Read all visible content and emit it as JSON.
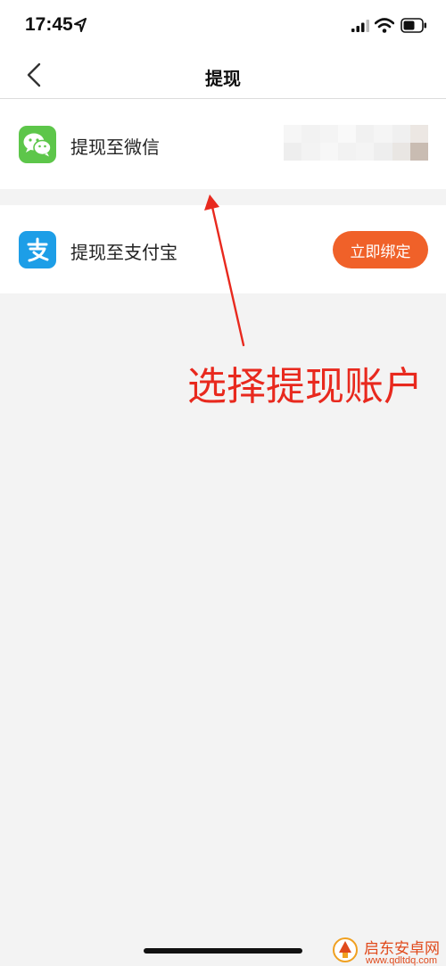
{
  "status_bar": {
    "time": "17:45",
    "icons": [
      "location-arrow-icon",
      "signal-icon",
      "wifi-icon",
      "battery-icon"
    ]
  },
  "nav": {
    "title": "提现",
    "back_icon": "chevron-left-icon"
  },
  "options": [
    {
      "label": "提现至微信",
      "icon": "wechat-icon",
      "account": ""
    },
    {
      "label": "提现至支付宝",
      "icon": "alipay-icon",
      "action_label": "立即绑定"
    }
  ],
  "annotation": {
    "text": "选择提现账户",
    "color": "#e8291e"
  },
  "watermark": {
    "name": "启东安卓网",
    "url": "www.qdltdq.com"
  },
  "colors": {
    "wechat_green": "#5dc64a",
    "alipay_blue": "#1d9ee7",
    "bind_button": "#f06129",
    "background": "#f3f3f3"
  }
}
